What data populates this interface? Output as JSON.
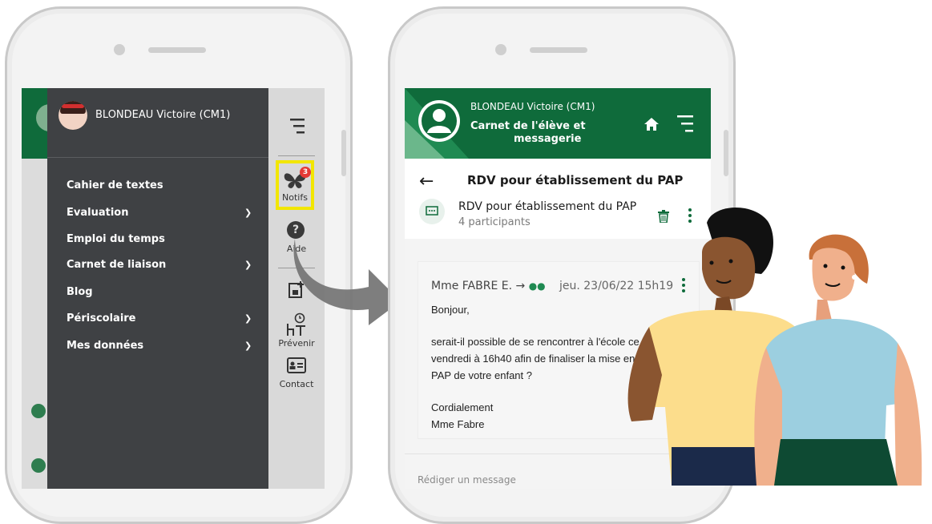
{
  "left_phone": {
    "user_name": "BLONDEAU Victoire (CM1)",
    "menu": [
      {
        "label": "Cahier de textes",
        "expandable": false
      },
      {
        "label": "Evaluation",
        "expandable": true
      },
      {
        "label": "Emploi du temps",
        "expandable": false
      },
      {
        "label": "Carnet de liaison",
        "expandable": true
      },
      {
        "label": "Blog",
        "expandable": false
      },
      {
        "label": "Périscolaire",
        "expandable": true
      },
      {
        "label": "Mes données",
        "expandable": true
      }
    ],
    "rail": {
      "notifs_label": "Notifs",
      "notifs_badge": "3",
      "aide_label": "Aide",
      "prevenir_label": "Prévenir",
      "contact_label": "Contact"
    }
  },
  "right_phone": {
    "header": {
      "user_name": "BLONDEAU Victoire (CM1)",
      "title_line1": "Carnet de l'élève et",
      "title_line2": "messagerie"
    },
    "thread": {
      "back_title": "RDV pour établissement du PAP",
      "subject": "RDV pour établissement du PAP",
      "participants": "4 participants"
    },
    "message": {
      "sender": "Mme FABRE E. →",
      "date": "jeu. 23/06/22 15h19",
      "greeting": "Bonjour,",
      "body_line1": "serait-il possible de se rencontrer à l'école ce",
      "body_line2": "vendredi à 16h40 afin de finaliser la mise en",
      "body_line3": "PAP de votre enfant ?",
      "closing": "Cordialement",
      "signature": "Mme Fabre"
    },
    "compose_placeholder": "Rédiger un message"
  },
  "colors": {
    "brand_green": "#0f6b3b",
    "drawer": "#3f4144",
    "highlight": "#f2e600",
    "badge": "#e53935"
  }
}
